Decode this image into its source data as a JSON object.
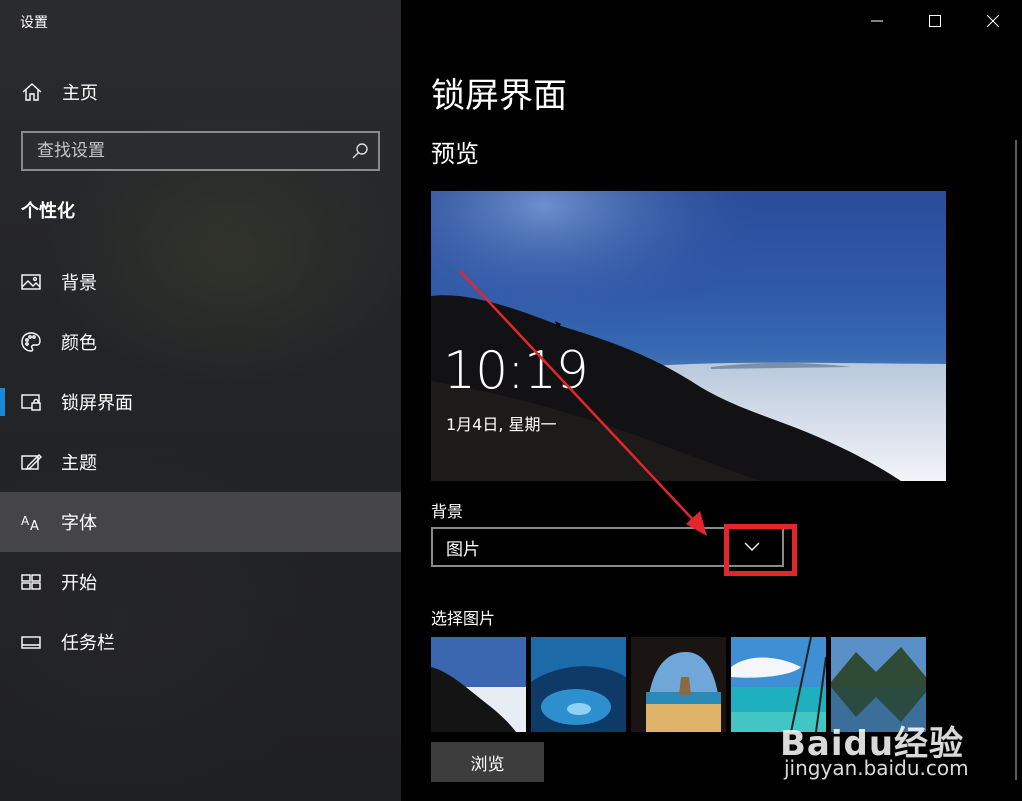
{
  "window": {
    "title": "设置"
  },
  "sidebar": {
    "home_label": "主页",
    "search_placeholder": "查找设置",
    "section": "个性化",
    "items": [
      {
        "label": "背景",
        "icon": "picture-icon"
      },
      {
        "label": "颜色",
        "icon": "palette-icon"
      },
      {
        "label": "锁屏界面",
        "icon": "lock-screen-icon",
        "selected": true
      },
      {
        "label": "主题",
        "icon": "theme-icon"
      },
      {
        "label": "字体",
        "icon": "font-icon",
        "hover": true
      },
      {
        "label": "开始",
        "icon": "start-icon"
      },
      {
        "label": "任务栏",
        "icon": "taskbar-icon"
      }
    ]
  },
  "main": {
    "title": "锁屏界面",
    "preview_heading": "预览",
    "lock_time": "10:19",
    "lock_date": "1月4日, 星期一",
    "background_label": "背景",
    "background_value": "图片",
    "choose_label": "选择图片",
    "thumbnails": [
      "mountain-sea-of-clouds",
      "ice-cave",
      "sea-arch-cave",
      "tropical-lagoon",
      "mountain-lake"
    ],
    "browse_label": "浏览"
  },
  "watermark": {
    "brand": "Baidu经验",
    "url": "jingyan.baidu.com"
  },
  "colors": {
    "accent": "#1a8ad8",
    "callout_red": "#e3262b",
    "sidebar_bg": "#232427",
    "hover_bg": "#454548"
  }
}
